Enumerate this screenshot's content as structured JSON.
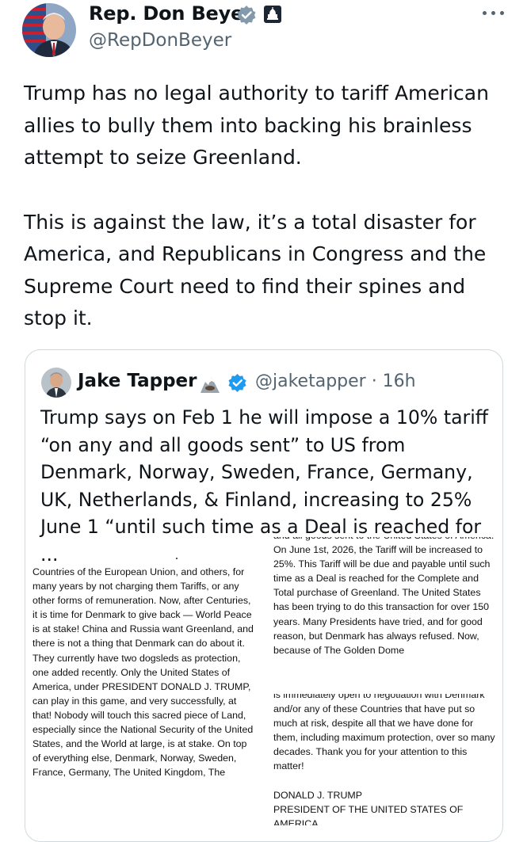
{
  "author": {
    "display_name": "Rep. Don Beyer",
    "handle": "@RepDonBeyer",
    "avatar_icon": "avatar-photo-icon",
    "verified_icon": "verified-badge-icon",
    "affiliation_icon": "us-government-capitol-icon"
  },
  "more_icon": "more-options-icon",
  "tweet": {
    "paragraphs": [
      "Trump has no legal authority to tariff American allies to bully them into backing his brainless attempt to seize Greenland.",
      "This is against the law, it’s a total disaster for America, and Republicans in Congress and the Supreme Court need to find their spines and stop it."
    ]
  },
  "quote": {
    "display_name": "Jake Tapper",
    "handle_time": "@jaketapper · 16h",
    "emoji_icon": "eagle-icon",
    "verified_icon": "verified-badge-icon",
    "text": "Trump says on Feb 1 he will impose a  10% tariff “on any and all goods sent” to US from Denmark, Norway, Sweden, France, Germany, UK, Netherlands, & Finland, increasing to 25% June 1 “until such time as a Deal is reached for ..."
  },
  "document": {
    "left_text": "Countries of the European Union, and others, for many years by not charging them Tariffs, or any other forms of remuneration. Now, after Centuries, it is time for Denmark to give back — World Peace is at stake! China and Russia want Greenland, and there is not a thing that Denmark can do about it. They currently have two dogsleds as protection, one added recently. Only the United States of America, under PRESIDENT DONALD J. TRUMP, can play in this game, and very successfully, at that! Nobody will touch this sacred piece of Land, especially since the National Security of the United States, and the World at large, is at stake. On top of everything else, Denmark, Norway, Sweden, France, Germany, The United Kingdom, The",
    "right_top_text": "and all goods sent to the United States of America. On June 1st, 2026, the Tariff will be increased to 25%. This Tariff will be due and payable until such time as a Deal is reached for the Complete and Total purchase of Greenland. The United States has been trying to do this transaction for over 150 years. Many Presidents have tried, and for good reason, but Denmark has always refused. Now, because of The Golden Dome",
    "right_bottom_text": "is immediately open to negotiation with Denmark and/or any of these Countries that have put so much at risk, despite all that we have done for them, including maximum protection, over so many decades. Thank you for your attention to this matter!",
    "signature": "DONALD J. TRUMP",
    "signature_title": "PRESIDENT OF THE UNITED STATES OF AMERICA"
  }
}
